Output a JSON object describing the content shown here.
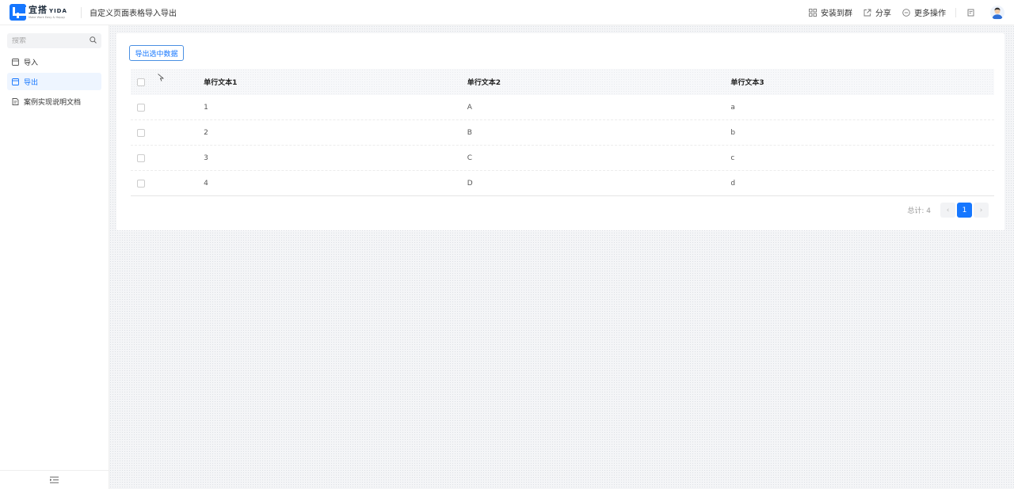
{
  "header": {
    "logo_name": "宜搭",
    "logo_sub": "YIDA",
    "logo_slogan": "Make Work Easy & Happy",
    "app_title": "自定义页面表格导入导出",
    "actions": [
      {
        "label": "安装到群",
        "icon": "grid-icon"
      },
      {
        "label": "分享",
        "icon": "share-icon"
      },
      {
        "label": "更多操作",
        "icon": "more-icon"
      }
    ]
  },
  "sidebar": {
    "search_placeholder": "搜索",
    "items": [
      {
        "label": "导入",
        "icon": "page-icon",
        "active": false
      },
      {
        "label": "导出",
        "icon": "page-icon",
        "active": true
      },
      {
        "label": "案例实现说明文档",
        "icon": "doc-icon",
        "active": false
      }
    ]
  },
  "main": {
    "export_button": "导出选中数据",
    "table": {
      "columns": [
        "单行文本1",
        "单行文本2",
        "单行文本3"
      ],
      "rows": [
        [
          "1",
          "A",
          "a"
        ],
        [
          "2",
          "B",
          "b"
        ],
        [
          "3",
          "C",
          "c"
        ],
        [
          "4",
          "D",
          "d"
        ]
      ]
    },
    "pagination": {
      "total_label": "总计: 4",
      "current_page": "1",
      "prev": "‹",
      "next": "›"
    }
  },
  "colors": {
    "accent": "#1677ff",
    "status_online": "#2bb24c"
  }
}
